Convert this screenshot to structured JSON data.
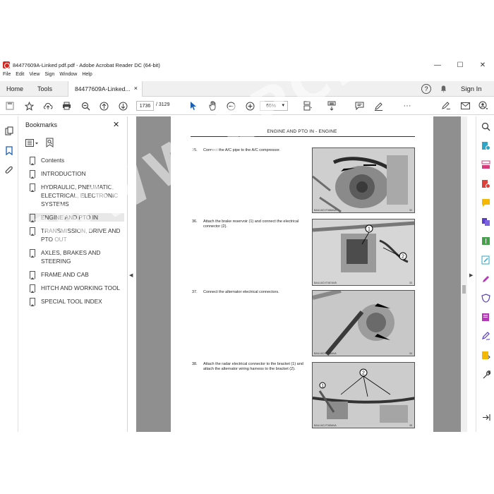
{
  "window": {
    "title": "84477609A-Linked pdf.pdf - Adobe Acrobat Reader DC (64-bit)",
    "controls": [
      "—",
      "☐",
      "✕"
    ]
  },
  "menu": [
    "File",
    "Edit",
    "View",
    "Sign",
    "Window",
    "Help"
  ],
  "tabs": {
    "home": "Home",
    "tools": "Tools",
    "doc": "84477609A-Linked...",
    "doc_close": "×",
    "help": "?",
    "signin": "Sign In"
  },
  "toolbar": {
    "page_current": "1736",
    "page_total": "/ 3129",
    "zoom": "66%",
    "more": "···"
  },
  "bookmarks": {
    "title": "Bookmarks",
    "close": "✕",
    "items": [
      {
        "label": "Contents"
      },
      {
        "label": "INTRODUCTION"
      },
      {
        "label": "HYDRAULIC, PNEUMATIC, ELECTRICAL, ELECTRONIC SYSTEMS"
      },
      {
        "label": "ENGINE AND PTO IN"
      },
      {
        "label": "TRANSMISSION, DRIVE AND PTO OUT"
      },
      {
        "label": "AXLES, BRAKES AND STEERING"
      },
      {
        "label": "FRAME AND CAB"
      },
      {
        "label": "HITCH AND WORKING TOOL"
      },
      {
        "label": "SPECIAL TOOL INDEX"
      }
    ]
  },
  "document": {
    "header": "ENGINE AND PTO IN - ENGINE",
    "steps": [
      {
        "num": "35.",
        "text": "Connect the A/C pipe to the A/C compressor.",
        "fig_code": "BAIL16CVT088AVA",
        "fig_no": "32"
      },
      {
        "num": "36.",
        "text": "Attach the brake reservoir (1) and connect the electrical connector (2).",
        "fig_code": "BAIL16CVT087AVB",
        "fig_no": "33"
      },
      {
        "num": "37.",
        "text": "Connect the alternator electrical connectors.",
        "fig_code": "BAIL16CVT086AVA",
        "fig_no": "34"
      },
      {
        "num": "38.",
        "text": "Attach the radar electrical connector to the bracket (1) and attach the alternator wiring harness to the bracket (2).",
        "fig_code": "BAIL16CVT085AVA",
        "fig_no": "35"
      }
    ]
  },
  "watermark": "WWW.EPCDEPOT.COM",
  "colors": {
    "acrobat_red": "#d7261e",
    "doc_bg": "#8f8f8f",
    "selected_bm": "#e8e8e8"
  }
}
